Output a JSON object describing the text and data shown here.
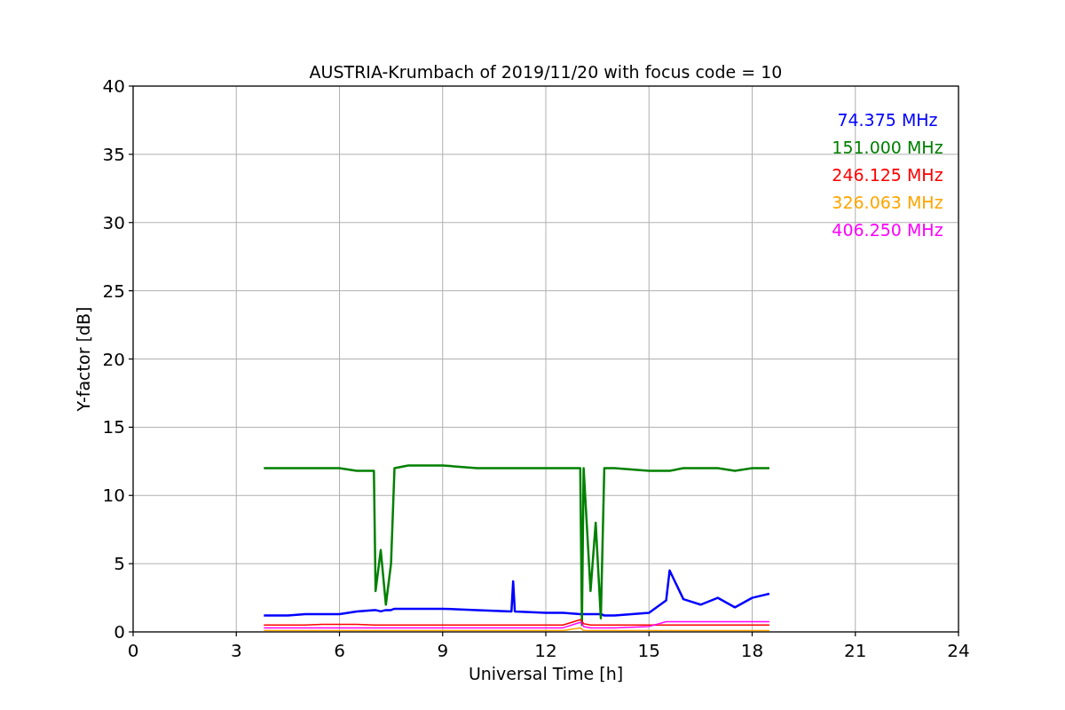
{
  "chart_data": {
    "type": "line",
    "title": "AUSTRIA-Krumbach of 2019/11/20 with focus code = 10",
    "xlabel": "Universal Time [h]",
    "ylabel": "Y-factor [dB]",
    "x": [
      3.8,
      4.5,
      5,
      5.5,
      6,
      6.5,
      7,
      7.05,
      7.2,
      7.35,
      7.5,
      7.6,
      8,
      9,
      10,
      11,
      11.05,
      11.1,
      12,
      12.5,
      13,
      13.05,
      13.1,
      13.3,
      13.45,
      13.6,
      13.7,
      14,
      15,
      15.5,
      15.6,
      16,
      16.5,
      17,
      17.5,
      18,
      18.5
    ],
    "series": [
      {
        "name": "74.375 MHz",
        "color": "#0000ff",
        "values": [
          1.2,
          1.2,
          1.3,
          1.3,
          1.3,
          1.5,
          1.6,
          1.6,
          1.5,
          1.6,
          1.6,
          1.7,
          1.7,
          1.7,
          1.6,
          1.5,
          3.7,
          1.5,
          1.4,
          1.4,
          1.3,
          1.3,
          1.3,
          1.3,
          1.3,
          1.3,
          1.2,
          1.2,
          1.4,
          2.3,
          4.5,
          2.4,
          2.0,
          2.5,
          1.8,
          2.5,
          2.8
        ]
      },
      {
        "name": "151.000 MHz",
        "color": "#008000",
        "values": [
          12,
          12,
          12,
          12,
          12,
          11.8,
          11.8,
          3,
          6,
          2,
          5,
          12,
          12.2,
          12.2,
          12,
          12,
          12,
          12,
          12,
          12,
          12,
          0.5,
          12,
          3,
          8,
          1,
          12,
          12,
          11.8,
          11.8,
          11.8,
          12,
          12,
          12,
          11.8,
          12,
          12
        ]
      },
      {
        "name": "246.125 MHz",
        "color": "#ff0000",
        "values": [
          0.5,
          0.5,
          0.5,
          0.55,
          0.55,
          0.55,
          0.5,
          0.5,
          0.5,
          0.5,
          0.5,
          0.5,
          0.5,
          0.5,
          0.5,
          0.5,
          0.5,
          0.5,
          0.5,
          0.5,
          0.9,
          0.8,
          0.6,
          0.5,
          0.5,
          0.5,
          0.5,
          0.5,
          0.5,
          0.5,
          0.5,
          0.5,
          0.5,
          0.5,
          0.5,
          0.5,
          0.5
        ]
      },
      {
        "name": "326.063 MHz",
        "color": "#ffa500",
        "values": [
          0.1,
          0.1,
          0.1,
          0.1,
          0.1,
          0.1,
          0.1,
          0.1,
          0.1,
          0.1,
          0.1,
          0.1,
          0.1,
          0.1,
          0.1,
          0.1,
          0.1,
          0.1,
          0.1,
          0.1,
          0.3,
          0.2,
          0.1,
          0.1,
          0.1,
          0.1,
          0.1,
          0.1,
          0.1,
          0.1,
          0.1,
          0.1,
          0.1,
          0.1,
          0.1,
          0.1,
          0.1
        ]
      },
      {
        "name": "406.250 MHz",
        "color": "#ff00ff",
        "values": [
          0.3,
          0.3,
          0.3,
          0.3,
          0.3,
          0.3,
          0.3,
          0.3,
          0.3,
          0.3,
          0.3,
          0.3,
          0.3,
          0.3,
          0.3,
          0.3,
          0.3,
          0.3,
          0.3,
          0.3,
          0.7,
          0.6,
          0.4,
          0.3,
          0.3,
          0.3,
          0.3,
          0.3,
          0.4,
          0.75,
          0.75,
          0.75,
          0.75,
          0.75,
          0.75,
          0.75,
          0.75
        ]
      }
    ],
    "grid": true,
    "xlim": [
      0,
      24
    ],
    "ylim": [
      0,
      40
    ],
    "xticks": [
      0,
      3,
      6,
      9,
      12,
      15,
      18,
      21,
      24
    ],
    "yticks": [
      0,
      5,
      10,
      15,
      20,
      25,
      30,
      35,
      40
    ]
  }
}
